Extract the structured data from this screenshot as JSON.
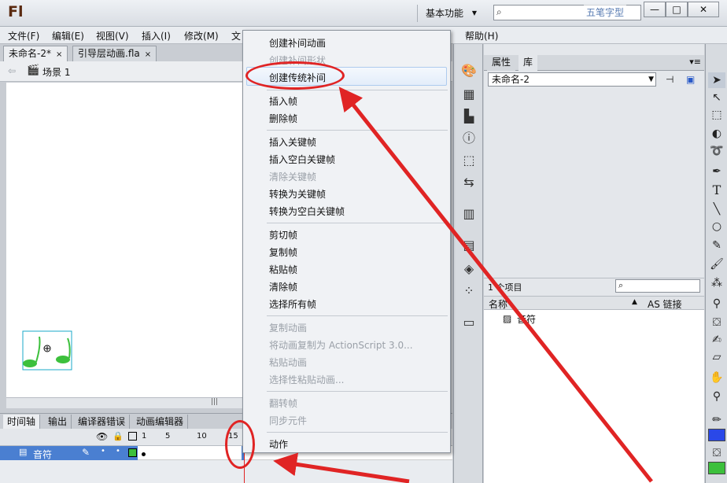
{
  "title_bar": {
    "app_logo": "Fl",
    "workspace_label": "基本功能",
    "search_placeholder": "",
    "watermark": "五笔字型",
    "min_label": "—",
    "max_label": "□",
    "close_label": "✕"
  },
  "menubar": {
    "items": [
      "文件(F)",
      "编辑(E)",
      "视图(V)",
      "插入(I)",
      "修改(M)",
      "文",
      "帮助(H)"
    ]
  },
  "doc_tabs": [
    {
      "label": "未命名-2*",
      "close": "×"
    },
    {
      "label": "引导层动画.fla",
      "close": "×"
    }
  ],
  "breadcrumb": {
    "scene": "场景 1"
  },
  "timeline": {
    "tabs": [
      "时间轴",
      "输出",
      "编译器错误",
      "动画编辑器"
    ],
    "ticks": [
      "1",
      "5",
      "10",
      "15"
    ],
    "layer_name": "音符"
  },
  "library": {
    "tabs": [
      "属性",
      "库"
    ],
    "doc_name": "未命名-2",
    "item_count": "1 个项目",
    "col_name": "名称",
    "col_link": "AS 链接",
    "items": [
      "音符"
    ]
  },
  "context_menu": {
    "items": [
      {
        "label": "创建补间动画",
        "disabled": false
      },
      {
        "label": "创建补间形状",
        "disabled": true
      },
      {
        "label": "创建传统补间",
        "disabled": false
      },
      {
        "label": "插入帧",
        "disabled": false
      },
      {
        "label": "删除帧",
        "disabled": false
      },
      {
        "label": "插入关键帧",
        "disabled": false
      },
      {
        "label": "插入空白关键帧",
        "disabled": false
      },
      {
        "label": "清除关键帧",
        "disabled": true
      },
      {
        "label": "转换为关键帧",
        "disabled": false
      },
      {
        "label": "转换为空白关键帧",
        "disabled": false
      },
      {
        "label": "剪切帧",
        "disabled": false
      },
      {
        "label": "复制帧",
        "disabled": false
      },
      {
        "label": "粘贴帧",
        "disabled": false
      },
      {
        "label": "清除帧",
        "disabled": false
      },
      {
        "label": "选择所有帧",
        "disabled": false
      },
      {
        "label": "复制动画",
        "disabled": true
      },
      {
        "label": "将动画复制为 ActionScript 3.0...",
        "disabled": true
      },
      {
        "label": "粘贴动画",
        "disabled": true
      },
      {
        "label": "选择性粘贴动画...",
        "disabled": true
      },
      {
        "label": "翻转帧",
        "disabled": true
      },
      {
        "label": "同步元件",
        "disabled": true
      },
      {
        "label": "动作",
        "disabled": false
      }
    ]
  },
  "colors": {
    "annotation_red": "#e02424",
    "layer_blue": "#4a7fd1",
    "stroke_color": "#2a48e8",
    "fill_color": "#3cc03c"
  }
}
